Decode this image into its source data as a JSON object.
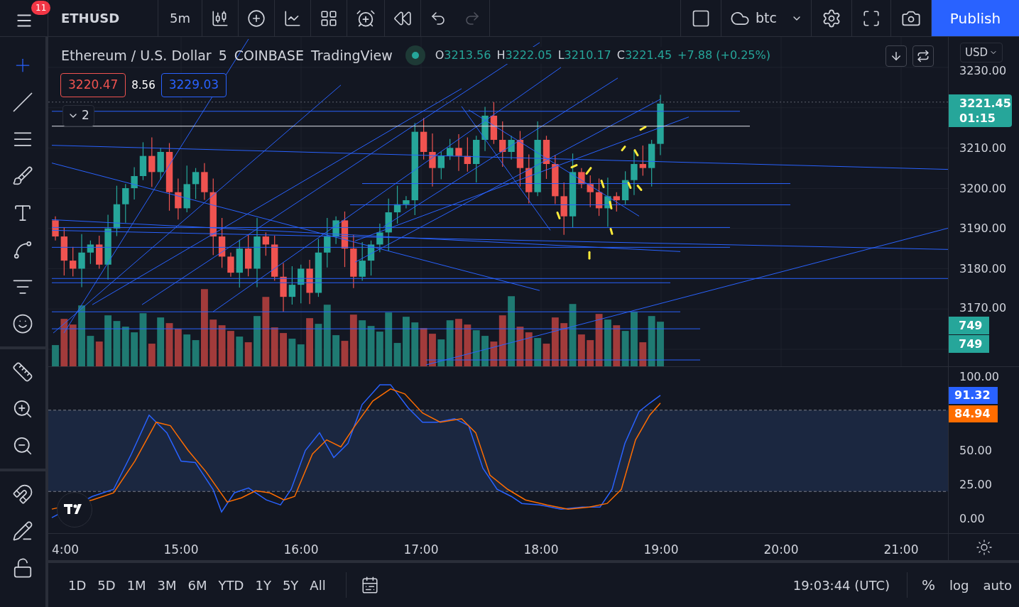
{
  "top_bar": {
    "notification_count": "11",
    "symbol": "ETHUSD",
    "interval": "5m",
    "undo_disabled": false,
    "redo_disabled": true,
    "layout_name": "btc",
    "publish": "Publish"
  },
  "left_toolbar": [
    {
      "kind": "crosshair",
      "selected": true
    },
    {
      "kind": "line",
      "selected": false
    },
    {
      "kind": "fib",
      "selected": false
    },
    {
      "kind": "brush",
      "selected": false
    },
    {
      "kind": "text",
      "selected": false
    },
    {
      "kind": "pattern",
      "selected": false
    },
    {
      "kind": "prediction",
      "selected": false
    },
    {
      "kind": "emoji",
      "selected": false
    },
    {
      "kind": "ruler",
      "selected": false
    },
    {
      "kind": "zoom_in",
      "selected": false
    },
    {
      "kind": "zoom_out",
      "selected": false
    },
    {
      "kind": "magnet",
      "selected": false
    },
    {
      "kind": "lock_drawing",
      "selected": false
    },
    {
      "kind": "lock",
      "selected": false
    }
  ],
  "legend": {
    "title": "Ethereum / U.S. Dollar",
    "interval": "5",
    "exchange": "COINBASE",
    "source": "TradingView",
    "open_label": "O",
    "open": "3213.56",
    "high_label": "H",
    "high": "3222.05",
    "low_label": "L",
    "low": "3210.17",
    "close_label": "C",
    "close": "3221.45",
    "change": "+7.88 (+0.25%)"
  },
  "bid_ask": {
    "sell": "3220.47",
    "spread": "8.56",
    "buy": "3229.03"
  },
  "indicators_toggle": {
    "count": "2"
  },
  "price_axis": {
    "currency": "USD",
    "ticks": [
      "3230.00",
      "3210.00",
      "3200.00",
      "3190.00",
      "3180.00",
      "3170.00"
    ],
    "last_price": "3221.45",
    "countdown": "01:15",
    "volume_labels": [
      "749",
      "749"
    ]
  },
  "oscillator_axis": {
    "ticks": [
      "100.00",
      "50.00",
      "25.00",
      "0.00"
    ],
    "k_value": "91.32",
    "d_value": "84.94"
  },
  "time_axis": [
    "4:00",
    "15:00",
    "16:00",
    "17:00",
    "18:00",
    "19:00",
    "20:00",
    "21:00"
  ],
  "bottom_bar": {
    "ranges": [
      "1D",
      "5D",
      "1M",
      "3M",
      "6M",
      "YTD",
      "1Y",
      "5Y",
      "All"
    ],
    "clock": "19:03:44 (UTC)",
    "percent": "%",
    "log": "log",
    "auto": "auto"
  }
}
